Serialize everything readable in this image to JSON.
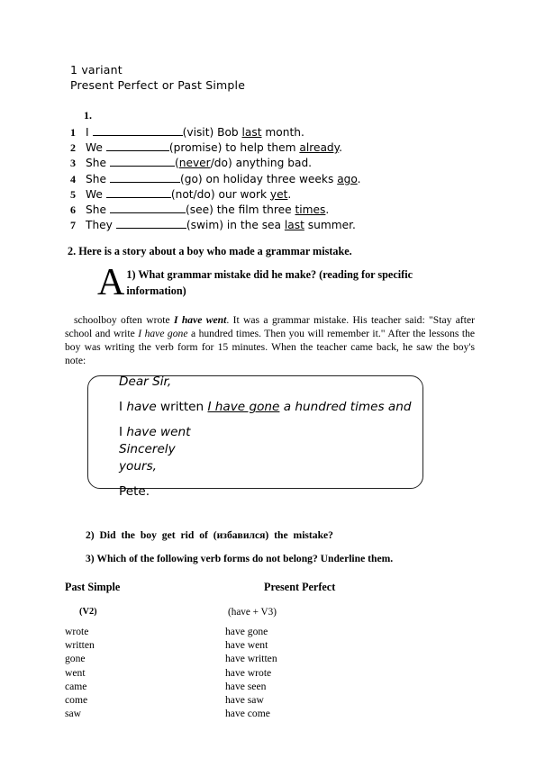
{
  "header": {
    "line1": "1 variant",
    "line2": "Present Perfect or Past Simple"
  },
  "exercise1": {
    "label": "1.",
    "items": [
      {
        "num": "1",
        "subject": "I",
        "blank_width": 100,
        "rest_pre": "(visit) Bob ",
        "underlined": "last",
        "rest_post": " month."
      },
      {
        "num": "2",
        "subject": "We",
        "blank_width": 70,
        "rest_pre": "(promise) to help them ",
        "underlined": "already",
        "rest_post": "."
      },
      {
        "num": "3",
        "subject": "She",
        "blank_width": 72,
        "rest_pre": "(",
        "underlined": "never",
        "rest_post": "/do) anything bad."
      },
      {
        "num": "4",
        "subject": "She",
        "blank_width": 78,
        "rest_pre": "(go) on holiday three weeks ",
        "underlined": "ago",
        "rest_post": "."
      },
      {
        "num": "5",
        "subject": "We",
        "blank_width": 72,
        "rest_pre": "(not/do) our work ",
        "underlined": "yet",
        "rest_post": "."
      },
      {
        "num": "6",
        "subject": "She",
        "blank_width": 84,
        "rest_pre": "(see) the film three ",
        "underlined": "times",
        "rest_post": "."
      },
      {
        "num": "7",
        "subject": "They",
        "blank_width": 78,
        "rest_pre": "(swim) in the sea ",
        "underlined": "last",
        "rest_post": " summer."
      }
    ]
  },
  "section2": {
    "heading": "2. Here is a story about a boy who made a grammar mistake.",
    "dropcap": "A",
    "question1": "1) What grammar mistake did he make? (reading for specific information)",
    "story_parts": [
      {
        "text": "schoolboy often wrote ",
        "style": "normal"
      },
      {
        "text": "I have went",
        "style": "bold-italic"
      },
      {
        "text": ". It was a grammar mistake. His teacher said: \"Stay after school and write ",
        "style": "normal"
      },
      {
        "text": "I have gone",
        "style": "italic"
      },
      {
        "text": " a hundred times. Then you will remember it.\" After the lessons the boy was writing the verb form for 15 minutes. When the teacher came back, he saw the boy's note:",
        "style": "normal"
      }
    ],
    "note": {
      "greeting": "Dear Sir,",
      "body_pre": "I ",
      "body_have": "have",
      "body_written": " written ",
      "body_quote": "I have gone",
      "body_post": " a hundred times and",
      "line3_i": "I ",
      "line3_have_went": "have went",
      "line4": "Sincerely",
      "line5": "yours,",
      "signature": "Pete."
    },
    "question2": "2) Did the boy get rid of (избавился) the mistake?",
    "question3": "3) Which of the following verb forms do not belong? Underline them."
  },
  "table": {
    "header_left": "Past Simple",
    "header_right": "Present Perfect",
    "sub_left": "(V2)",
    "sub_right": "(have + V3)",
    "col_left": [
      "wrote",
      "written",
      "gone",
      "went",
      "came",
      "come",
      "saw"
    ],
    "col_right": [
      "have gone",
      "have went",
      "have written",
      "have wrote",
      "have seen",
      "have saw",
      "have come"
    ]
  }
}
